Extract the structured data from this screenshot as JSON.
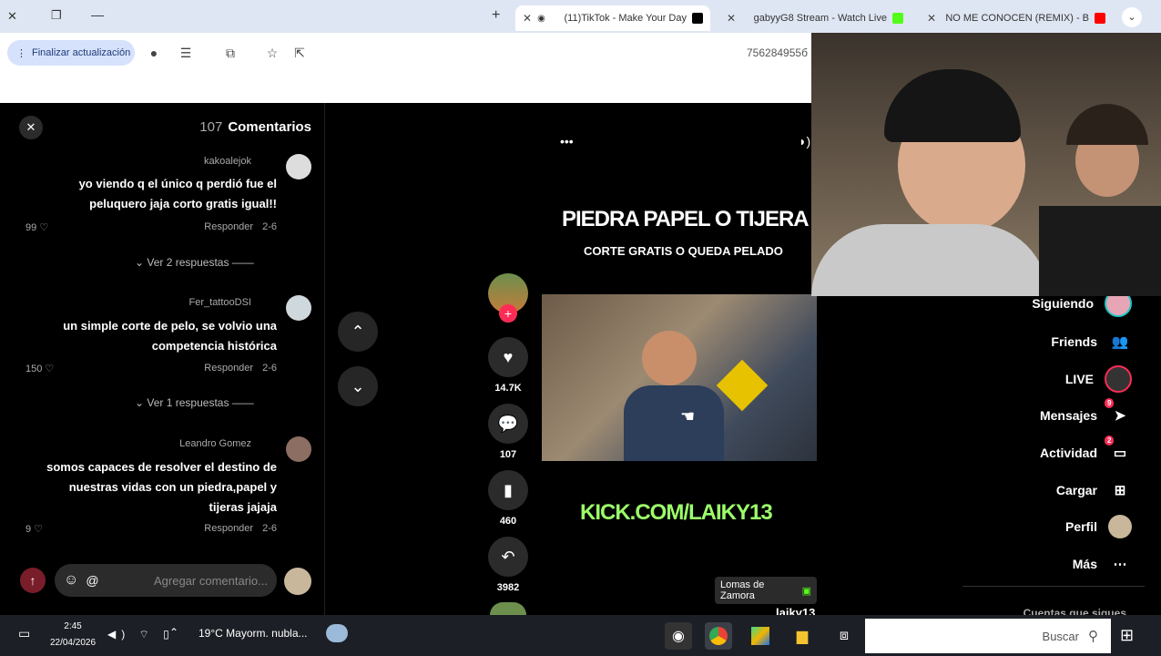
{
  "browser": {
    "tabs": [
      {
        "title": "NO ME CONOCEN (REMIX) - B",
        "icon": "youtube-icon",
        "color": "#ff0000"
      },
      {
        "title": "gabyyG8 Stream - Watch Live",
        "icon": "kick-icon",
        "color": "#53fc18"
      },
      {
        "title": "(11)TikTok - Make Your Day",
        "icon": "tiktok-icon",
        "color": "#000000"
      }
    ],
    "new_tab": "+",
    "address_partial": "756284955б",
    "update_button": "Finalizar actualización"
  },
  "comments_panel": {
    "title": "Comentarios",
    "count": "107",
    "close": "✕",
    "comments": [
      {
        "user": "kakoalejok",
        "text_lines": [
          "yo viendo q el único q perdió fue el",
          "peluquero jaja corto gratis igual!!"
        ],
        "date": "2-6",
        "reply": "Responder",
        "likes": "99",
        "replies": "Ver 2 respuestas"
      },
      {
        "user": "Fer_tattooDSI",
        "text_lines": [
          "un simple corte de pelo, se volvio una",
          "competencia histórica"
        ],
        "date": "2-6",
        "reply": "Responder",
        "likes": "150",
        "replies": "Ver 1 respuestas"
      },
      {
        "user": "Leandro Gomez",
        "text_lines": [
          "somos capaces de resolver el destino de",
          "nuestras vidas con un piedra,papel y",
          "tijeras jajaja"
        ],
        "date": "2-6",
        "reply": "Responder",
        "likes": "9"
      }
    ],
    "input_placeholder": "Agregar comentario..."
  },
  "video": {
    "title_text": "PIEDRA PAPEL O TIJERA",
    "subtitle_text": "CORTE GRATIS O QUEDA PELADO",
    "watermark": "KICK.COM/LAIKY13",
    "location_tag": "Lomas de Zamora",
    "author": "laiky13",
    "more": "•••",
    "likes": "14.7K",
    "comments": "107",
    "saves": "460",
    "shares": "3982"
  },
  "sidebar": {
    "items": [
      {
        "label": "Siguiendo",
        "icon": "following-avatar-icon"
      },
      {
        "label": "Friends",
        "icon": "friends-icon"
      },
      {
        "label": "LIVE",
        "icon": "live-icon"
      },
      {
        "label": "Mensajes",
        "icon": "messages-icon",
        "badge": "9"
      },
      {
        "label": "Actividad",
        "icon": "activity-icon",
        "badge": "2"
      },
      {
        "label": "Cargar",
        "icon": "upload-icon"
      },
      {
        "label": "Perfil",
        "icon": "profile-avatar-icon"
      },
      {
        "label": "Más",
        "icon": "more-icon"
      }
    ],
    "following_partial": "Cuentas que sigues"
  },
  "taskbar": {
    "search_placeholder": "Buscar",
    "weather": "19°C  Mayorm. nubla...",
    "time": "2:45",
    "date": "22/04/2026"
  },
  "colors": {
    "tiktok_red": "#fe2c55",
    "kick_green": "#53fc18",
    "taskbar": "#1c1f25"
  }
}
